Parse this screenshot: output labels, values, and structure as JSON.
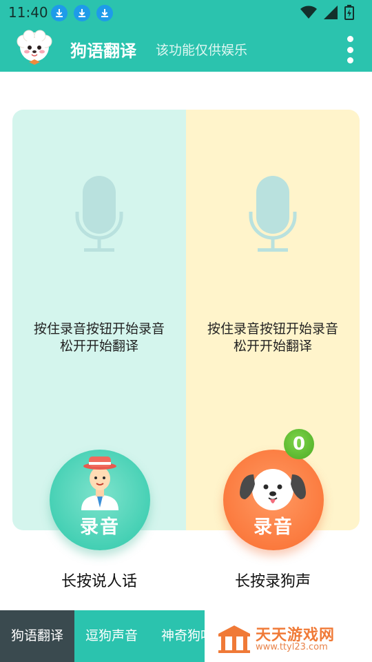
{
  "status_bar": {
    "time": "11:40",
    "icons": [
      "download-icon",
      "download-icon",
      "download-icon",
      "wifi-icon",
      "signal-icon",
      "battery-charging-icon"
    ],
    "bg_color": "#2bc3ae"
  },
  "app_bar": {
    "title": "狗语翻译",
    "subtitle": "该功能仅供娱乐",
    "logo": "dog-logo-icon",
    "menu": "more-vert-icon"
  },
  "panels": {
    "left": {
      "hint_line1": "按住录音按钮开始录音",
      "hint_line2": "松开开始翻译",
      "button_label": "录音",
      "caption": "长按说人话",
      "bg_color": "#d4f5ed",
      "button_color": "#45d0b4"
    },
    "right": {
      "hint_line1": "按住录音按钮开始录音",
      "hint_line2": "松开开始翻译",
      "button_label": "录音",
      "caption": "长按录狗声",
      "badge": "0",
      "bg_color": "#fff4cb",
      "button_color": "#fb7a3e"
    }
  },
  "bottom_nav": {
    "tabs": [
      {
        "label": "狗语翻译",
        "active": true
      },
      {
        "label": "逗狗声音",
        "active": false
      },
      {
        "label": "神奇狗哨",
        "active": false
      }
    ]
  },
  "watermark": {
    "title": "天天游戏网",
    "url": "www.ttyl23.com"
  }
}
